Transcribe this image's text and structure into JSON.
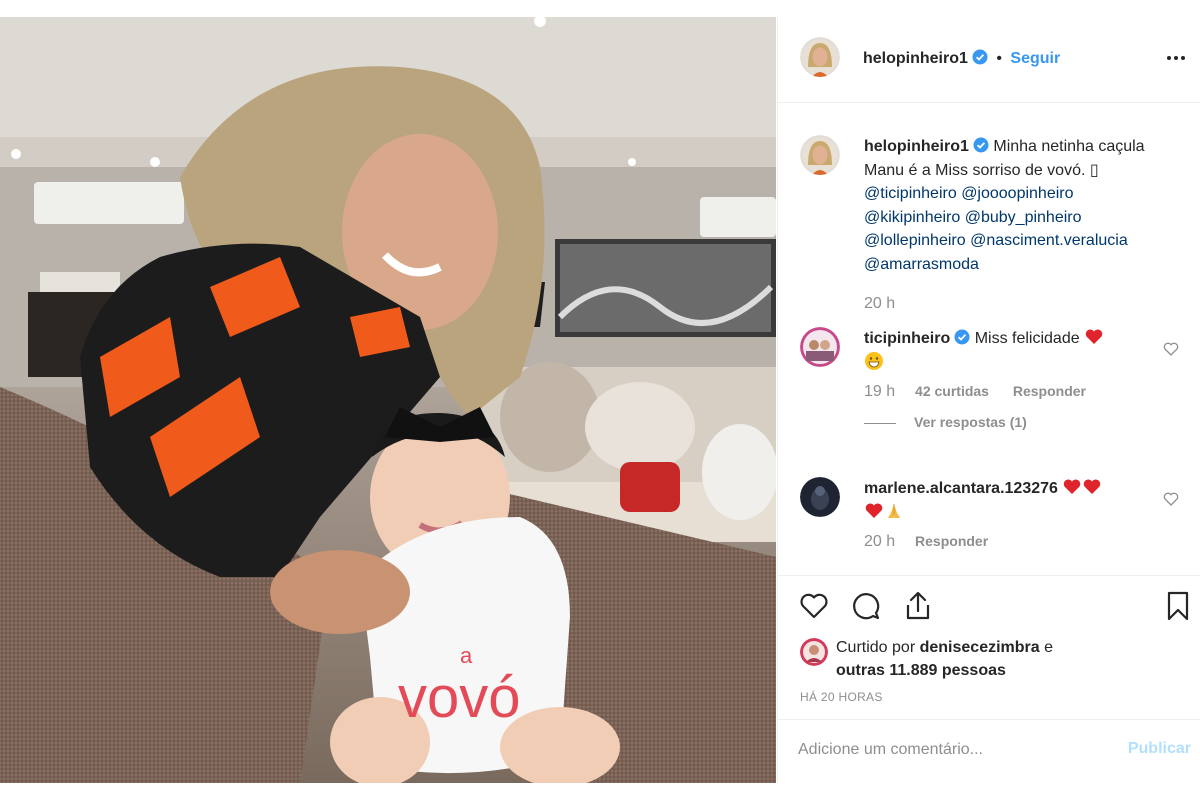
{
  "post": {
    "author": "helopinheiro1",
    "follow_label": "Seguir",
    "separator": "•"
  },
  "caption": {
    "username": "helopinheiro1",
    "text": "Minha netinha caçula Manu é a Miss sorriso de vovó. ",
    "text_end_glyph": "▯",
    "mentions": [
      "@ticipinheiro",
      "@joooopinheiro",
      "@kikipinheiro",
      "@buby_pinheiro",
      "@lollepinheiro",
      "@nasciment.veralucia",
      "@amarrasmoda"
    ],
    "time": "20 h"
  },
  "comments": [
    {
      "username": "ticipinheiro",
      "verified": true,
      "text": "Miss felicidade",
      "time": "19 h",
      "likes": "42 curtidas",
      "reply_label": "Responder",
      "view_replies": "Ver respostas (1)"
    },
    {
      "username": "marlene.alcantara.123276",
      "verified": false,
      "text": "",
      "time": "20 h",
      "reply_label": "Responder"
    }
  ],
  "likes": {
    "prefix": "Curtido por",
    "user": "denisecezimbra",
    "conjunction": "e",
    "others": "outras 11.889 pessoas"
  },
  "time_ago": "HÁ 20 HORAS",
  "add_comment": {
    "placeholder": "Adicione um comentário...",
    "publish_label": "Publicar"
  },
  "photo": {
    "onesie_text": "vovó",
    "onesie_small": "a"
  },
  "colors": {
    "accent": "#3897f0",
    "mention": "#00376b",
    "verified": "#3897f0",
    "heart": "#ed4956",
    "publish_disabled": "#b2dffc"
  }
}
